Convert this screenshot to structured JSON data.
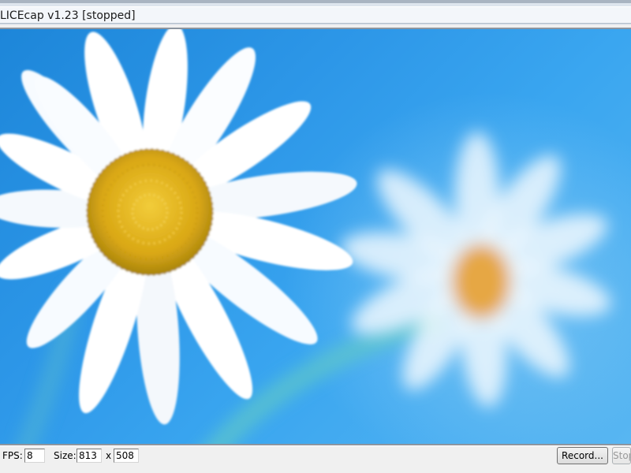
{
  "window": {
    "title": "LICEcap v1.23 [stopped]"
  },
  "capture": {
    "wallpaper_colors": {
      "sky_top": "#1d86d9",
      "sky_bottom": "#58b6f2",
      "petal": "#ffffff",
      "center": "#e8b81f",
      "stem": "#5ec7c9"
    }
  },
  "controls": {
    "fps_label": "FPS:",
    "fps_value": "8",
    "size_label": "Size:",
    "width_value": "813",
    "x_label": "x",
    "height_value": "508",
    "record_label": "Record...",
    "stop_label": "Stop"
  }
}
